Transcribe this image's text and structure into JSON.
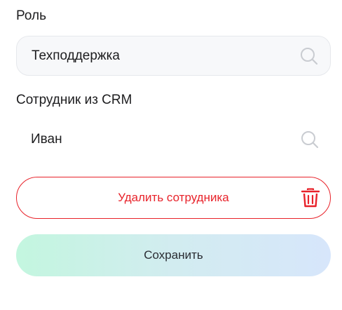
{
  "role": {
    "label": "Роль",
    "value": "Техподдержка"
  },
  "employee": {
    "label": "Сотрудник из CRM",
    "value": "Иван"
  },
  "actions": {
    "delete_label": "Удалить сотрудника",
    "save_label": "Сохранить"
  },
  "icons": {
    "search": "search-icon",
    "trash": "trash-icon"
  },
  "colors": {
    "danger": "#e8222a",
    "field_bg": "#f7f8fa",
    "field_border": "#e6e8ec",
    "save_gradient_start": "#c3f6df",
    "save_gradient_end": "#d7e6fb",
    "text": "#1d1d1f"
  }
}
